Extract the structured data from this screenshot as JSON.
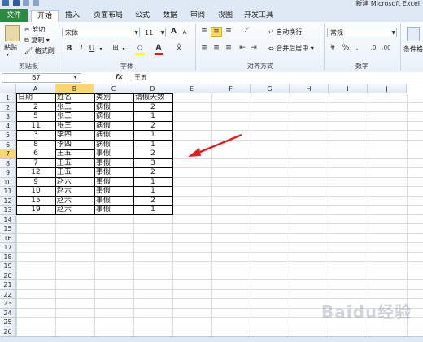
{
  "app": {
    "window_title": "新建 Microsoft Excel"
  },
  "tabs": {
    "file": "文件",
    "items": [
      "开始",
      "插入",
      "页面布局",
      "公式",
      "数据",
      "审阅",
      "视图",
      "开发工具"
    ]
  },
  "ribbon": {
    "clipboard": {
      "paste": "粘贴",
      "cut": "剪切",
      "copy": "复制 ▾",
      "format_painter": "格式刷",
      "label": "剪贴板"
    },
    "font": {
      "name": "宋体",
      "size": "11",
      "label": "字体",
      "bold": "B",
      "italic": "I",
      "underline": "U",
      "grow": "A",
      "shrink": "A",
      "wen": "文"
    },
    "alignment": {
      "wrap": "自动换行",
      "merge": "合并后居中",
      "label": "对齐方式"
    },
    "number": {
      "format": "常规",
      "label": "数字",
      "percent": "%",
      "comma": ","
    },
    "styles": {
      "conditional": "条件格"
    }
  },
  "formula_bar": {
    "name_box": "B7",
    "fx": "fx",
    "content": "王五"
  },
  "columns": [
    "A",
    "B",
    "C",
    "D",
    "E",
    "F",
    "G",
    "H",
    "I",
    "J"
  ],
  "rows": [
    "1",
    "2",
    "3",
    "4",
    "5",
    "6",
    "7",
    "8",
    "9",
    "10",
    "11",
    "12",
    "13",
    "14",
    "15",
    "16",
    "17",
    "18",
    "19",
    "20",
    "21",
    "22",
    "23",
    "24",
    "25",
    "26"
  ],
  "table": {
    "headers": [
      "日期",
      "姓名",
      "类别",
      "请假天数"
    ],
    "rows": [
      [
        "2",
        "张三",
        "病假",
        "2"
      ],
      [
        "5",
        "张三",
        "病假",
        "1"
      ],
      [
        "11",
        "张三",
        "病假",
        "2"
      ],
      [
        "3",
        "李四",
        "病假",
        "1"
      ],
      [
        "8",
        "李四",
        "病假",
        "1"
      ],
      [
        "6",
        "王五",
        "事假",
        "2"
      ],
      [
        "7",
        "王五",
        "事假",
        "3"
      ],
      [
        "12",
        "王五",
        "事假",
        "2"
      ],
      [
        "9",
        "赵六",
        "事假",
        "1"
      ],
      [
        "10",
        "赵六",
        "事假",
        "1"
      ],
      [
        "15",
        "赵六",
        "事假",
        "2"
      ],
      [
        "19",
        "赵六",
        "事假",
        "1"
      ]
    ]
  },
  "active_cell": "B7",
  "colors": {
    "file_tab": "#2a8a3e",
    "selection": "#fbd774",
    "annotation_arrow": "#e02020"
  },
  "watermark": "Baidu经验"
}
